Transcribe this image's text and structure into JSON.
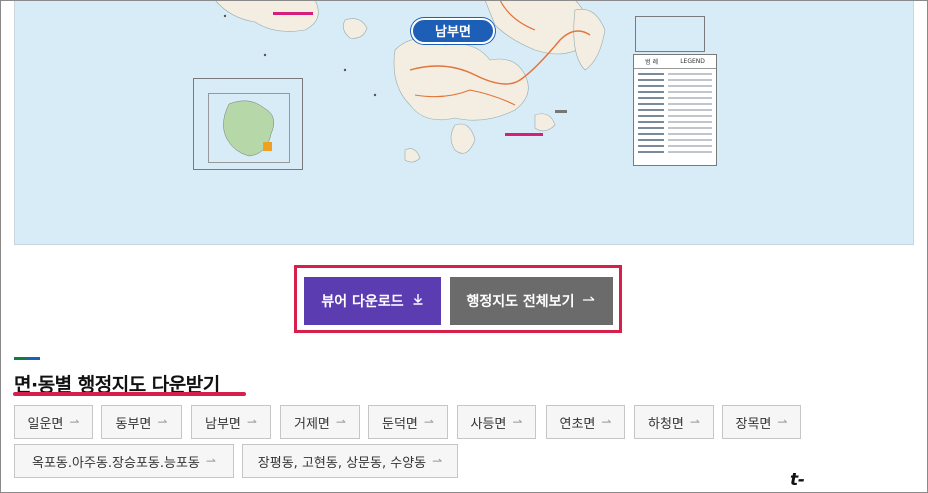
{
  "map": {
    "area_label": "남부면",
    "legend_title_left": "범 례",
    "legend_title_right": "LEGEND",
    "colors": {
      "sea": "#d7ecf7",
      "land": "#f3ede2",
      "road": "#e3743a",
      "pill": "#1d5fb6"
    }
  },
  "actions": {
    "viewer_label": "뷰어 다운로드",
    "viewer_icon": "download-icon",
    "full_label": "행정지도 전체보기",
    "full_icon": "arrow-right-icon"
  },
  "section": {
    "title": "면·동별 행정지도 다운받기",
    "accent_colors": [
      "#0b7d4a",
      "#1a5fb8"
    ],
    "highlight_color": "#d6204b"
  },
  "chips_row1": [
    {
      "label": "일운면"
    },
    {
      "label": "동부면"
    },
    {
      "label": "남부면"
    },
    {
      "label": "거제면"
    },
    {
      "label": "둔덕면"
    },
    {
      "label": "사등면"
    },
    {
      "label": "연초면"
    },
    {
      "label": "하청면"
    },
    {
      "label": "장목면"
    }
  ],
  "chips_row2": [
    {
      "label": "옥포동.아주동.장승포동.능포동"
    },
    {
      "label": "장평동, 고현동, 상문동, 수양동"
    }
  ],
  "arrow_glyph": "⇀",
  "watermark": "t-on.tistory.com"
}
